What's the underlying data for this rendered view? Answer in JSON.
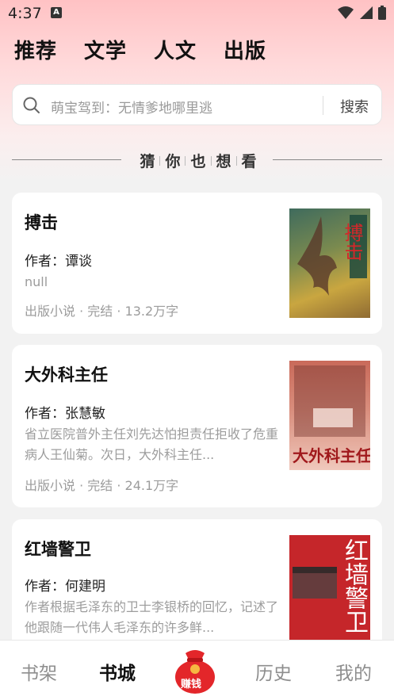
{
  "status": {
    "time": "4:37"
  },
  "top_tabs": [
    {
      "label": "推荐"
    },
    {
      "label": "文学"
    },
    {
      "label": "人文"
    },
    {
      "label": "出版"
    }
  ],
  "search": {
    "placeholder": "萌宝驾到：无情爹地哪里逃",
    "button_label": "搜索"
  },
  "section": {
    "chars": [
      "猜",
      "你",
      "也",
      "想",
      "看"
    ]
  },
  "books": [
    {
      "title": "搏击",
      "author": "作者：谭谈",
      "description": "null",
      "meta": "出版小说 · 完结 · 13.2万字",
      "cover_text": "搏击"
    },
    {
      "title": "大外科主任",
      "author": "作者：张慧敏",
      "description": "省立医院普外主任刘先达怕担责任拒收了危重病人王仙菊。次日，大外科主任...",
      "meta": "出版小说 · 完结 · 24.1万字",
      "cover_text": "大外科主任"
    },
    {
      "title": "红墙警卫",
      "author": "作者：何建明",
      "description": "作者根据毛泽东的卫士李银桥的回忆，记述了他跟随一代伟人毛泽东的许多鲜...",
      "meta": "",
      "cover_text": "红墙警卫"
    }
  ],
  "bottom_nav": {
    "items": [
      {
        "label": "书架"
      },
      {
        "label": "书城"
      },
      {
        "label": "历史"
      },
      {
        "label": "我的"
      }
    ],
    "earn_label": "赚钱"
  },
  "colors": {
    "accent_red": "#e3262a",
    "header_pink": "#ffc2c4"
  }
}
